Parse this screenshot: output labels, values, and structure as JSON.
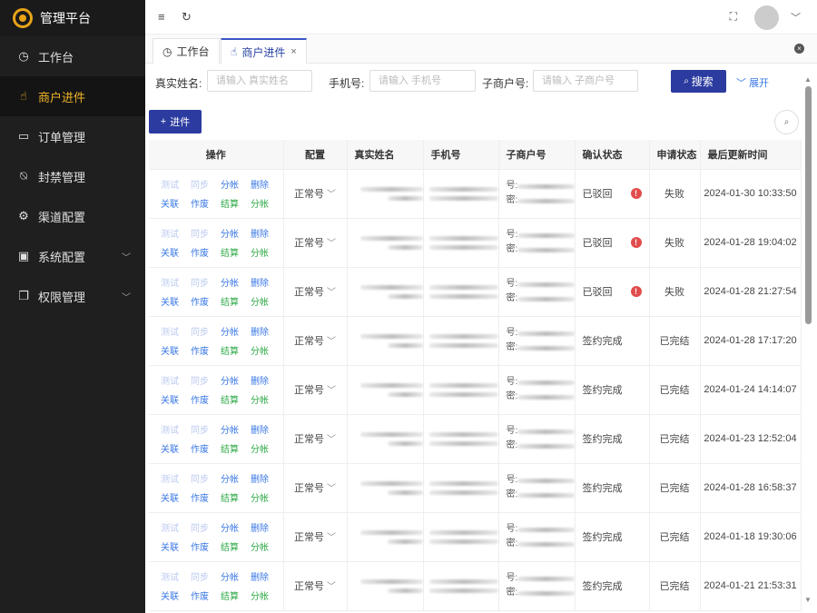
{
  "app": {
    "title": "管理平台"
  },
  "sidebar": {
    "items": [
      {
        "label": "工作台",
        "icon": "dashboard-icon"
      },
      {
        "label": "商户进件",
        "icon": "hand-icon"
      },
      {
        "label": "订单管理",
        "icon": "folder-icon"
      },
      {
        "label": "封禁管理",
        "icon": "ban-icon"
      },
      {
        "label": "渠道配置",
        "icon": "settings-icon"
      },
      {
        "label": "系统配置",
        "icon": "chip-icon"
      },
      {
        "label": "权限管理",
        "icon": "copy-icon"
      }
    ]
  },
  "tabs": [
    {
      "label": "工作台"
    },
    {
      "label": "商户进件"
    }
  ],
  "search": {
    "name_label": "真实姓名:",
    "name_placeholder": "请输入 真实姓名",
    "phone_label": "手机号:",
    "phone_placeholder": "请输入 手机号",
    "sub_label": "子商户号:",
    "sub_placeholder": "请输入 子商户号",
    "search_btn": "搜索",
    "expand": "展开"
  },
  "toolbar": {
    "add_label": "进件"
  },
  "table": {
    "headers": [
      "操作",
      "配置",
      "真实姓名",
      "手机号",
      "子商户号",
      "确认状态",
      "申请状态",
      "最后更新时间"
    ],
    "ops_row1": [
      "测试",
      "同步",
      "分帐",
      "删除"
    ],
    "ops_row2": [
      "关联",
      "作废",
      "结算",
      "分帐"
    ],
    "sub_labels": [
      "号:",
      "密:"
    ],
    "rows": [
      {
        "config": "正常号",
        "confirm": "已驳回",
        "warn": true,
        "apply": "失败",
        "time": "2024-01-30 10:33:50"
      },
      {
        "config": "正常号",
        "confirm": "已驳回",
        "warn": true,
        "apply": "失败",
        "time": "2024-01-28 19:04:02"
      },
      {
        "config": "正常号",
        "confirm": "已驳回",
        "warn": true,
        "apply": "失败",
        "time": "2024-01-28 21:27:54"
      },
      {
        "config": "正常号",
        "confirm": "签约完成",
        "warn": false,
        "apply": "已完结",
        "time": "2024-01-28 17:17:20"
      },
      {
        "config": "正常号",
        "confirm": "签约完成",
        "warn": false,
        "apply": "已完结",
        "time": "2024-01-24 14:14:07"
      },
      {
        "config": "正常号",
        "confirm": "签约完成",
        "warn": false,
        "apply": "已完结",
        "time": "2024-01-23 12:52:04"
      },
      {
        "config": "正常号",
        "confirm": "签约完成",
        "warn": false,
        "apply": "已完结",
        "time": "2024-01-28 16:58:37"
      },
      {
        "config": "正常号",
        "confirm": "签约完成",
        "warn": false,
        "apply": "已完结",
        "time": "2024-01-18 19:30:06"
      },
      {
        "config": "正常号",
        "confirm": "签约完成",
        "warn": false,
        "apply": "已完结",
        "time": "2024-01-21 21:53:31"
      }
    ]
  },
  "colors": {
    "accent": "#2b3b9f",
    "active_nav": "#f0b429",
    "link": "#3a78e5",
    "success": "#2eaa47",
    "danger": "#e14c4c"
  }
}
